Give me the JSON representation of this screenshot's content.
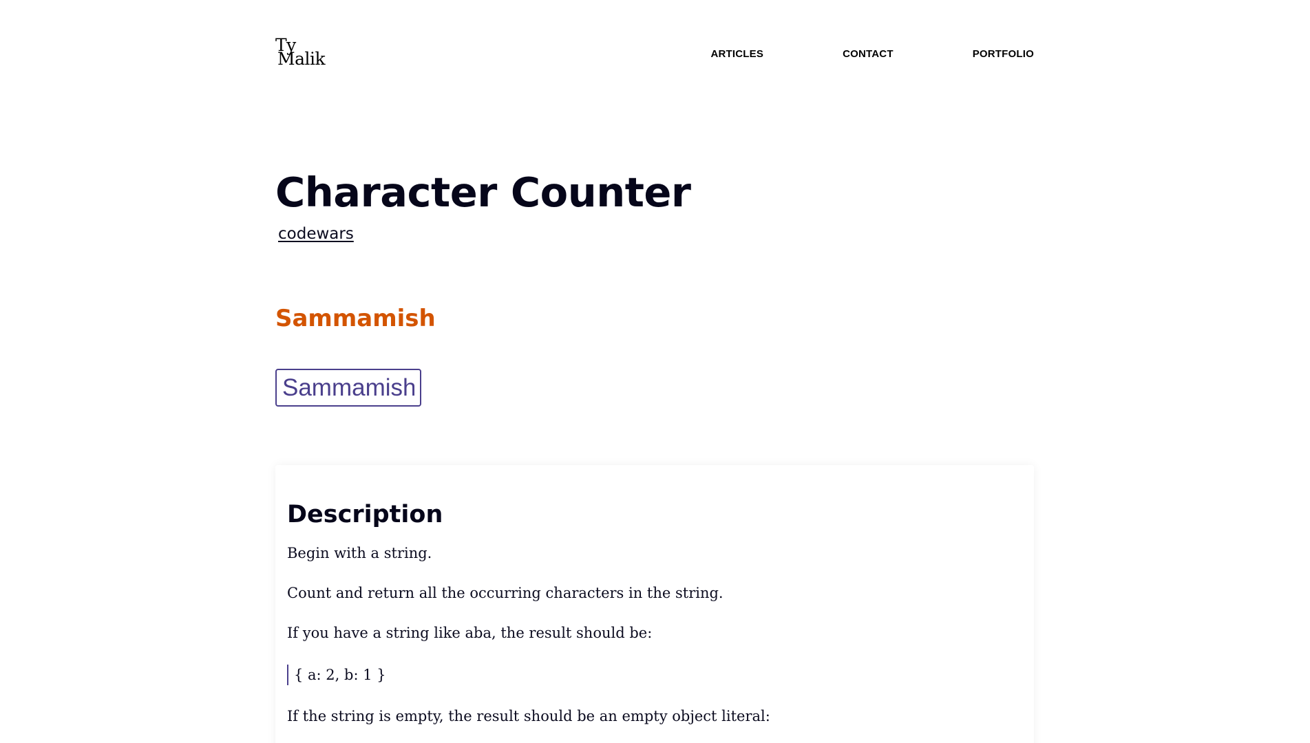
{
  "header": {
    "logo_line1": "Ty",
    "logo_line2": "Malik",
    "nav": {
      "articles": "ARTICLES",
      "contact": "CONTACT",
      "portfolio": "PORTFOLIO"
    }
  },
  "main": {
    "title": "Character Counter",
    "tag": "codewars",
    "demo": {
      "output": "Sammamish",
      "input_value": "Sammamish"
    }
  },
  "description": {
    "heading": "Description",
    "p1": "Begin with a string.",
    "p2": "Count and return all the occurring characters in the string.",
    "p3": "If you have a string like aba, the result should be:",
    "example": "{ a: 2, b: 1 }",
    "p4": "If the string is empty, the result should be an empty object literal:"
  },
  "colors": {
    "accent_output": "#d35400",
    "input_border": "#4a3f8c",
    "text": "#0b0b1f"
  }
}
